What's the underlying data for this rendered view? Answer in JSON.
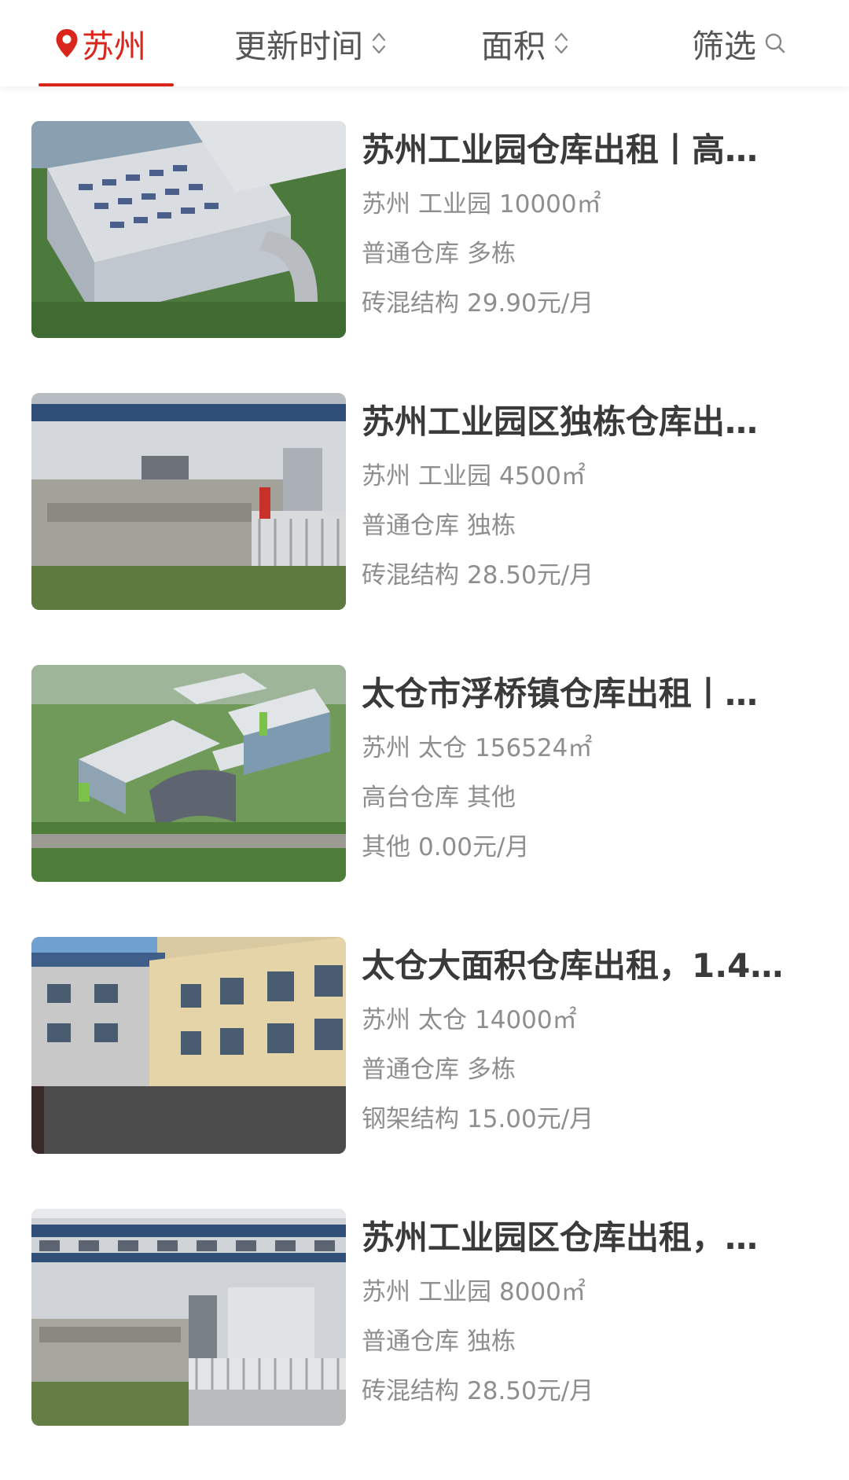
{
  "filter_bar": {
    "location": "苏州",
    "update_time": "更新时间",
    "area": "面积",
    "filter": "筛选",
    "accent_color": "#d9251c"
  },
  "listings": [
    {
      "title": "苏州工业园仓库出租丨高…",
      "city": "苏州",
      "district": "工业园",
      "area": "10000㎡",
      "type": "普通仓库",
      "building": "多栋",
      "structure": "砖混结构",
      "price": "29.90元/月",
      "image": "warehouse-aerial-solar"
    },
    {
      "title": "苏州工业园区独栋仓库出…",
      "city": "苏州",
      "district": "工业园",
      "area": "4500㎡",
      "type": "普通仓库",
      "building": "独栋",
      "structure": "砖混结构",
      "price": "28.50元/月",
      "image": "warehouse-gate-front"
    },
    {
      "title": "太仓市浮桥镇仓库出租丨…",
      "city": "苏州",
      "district": "太仓",
      "area": "156524㎡",
      "type": "高台仓库",
      "building": "其他",
      "structure": "其他",
      "price": "0.00元/月",
      "image": "warehouse-aerial-green"
    },
    {
      "title": "太仓大面积仓库出租，1.4…",
      "city": "苏州",
      "district": "太仓",
      "area": "14000㎡",
      "type": "普通仓库",
      "building": "多栋",
      "structure": "钢架结构",
      "price": "15.00元/月",
      "image": "warehouse-courtyard"
    },
    {
      "title": "苏州工业园区仓库出租，…",
      "city": "苏州",
      "district": "工业园",
      "area": "8000㎡",
      "type": "普通仓库",
      "building": "独栋",
      "structure": "砖混结构",
      "price": "28.50元/月",
      "image": "warehouse-gate-side"
    }
  ]
}
